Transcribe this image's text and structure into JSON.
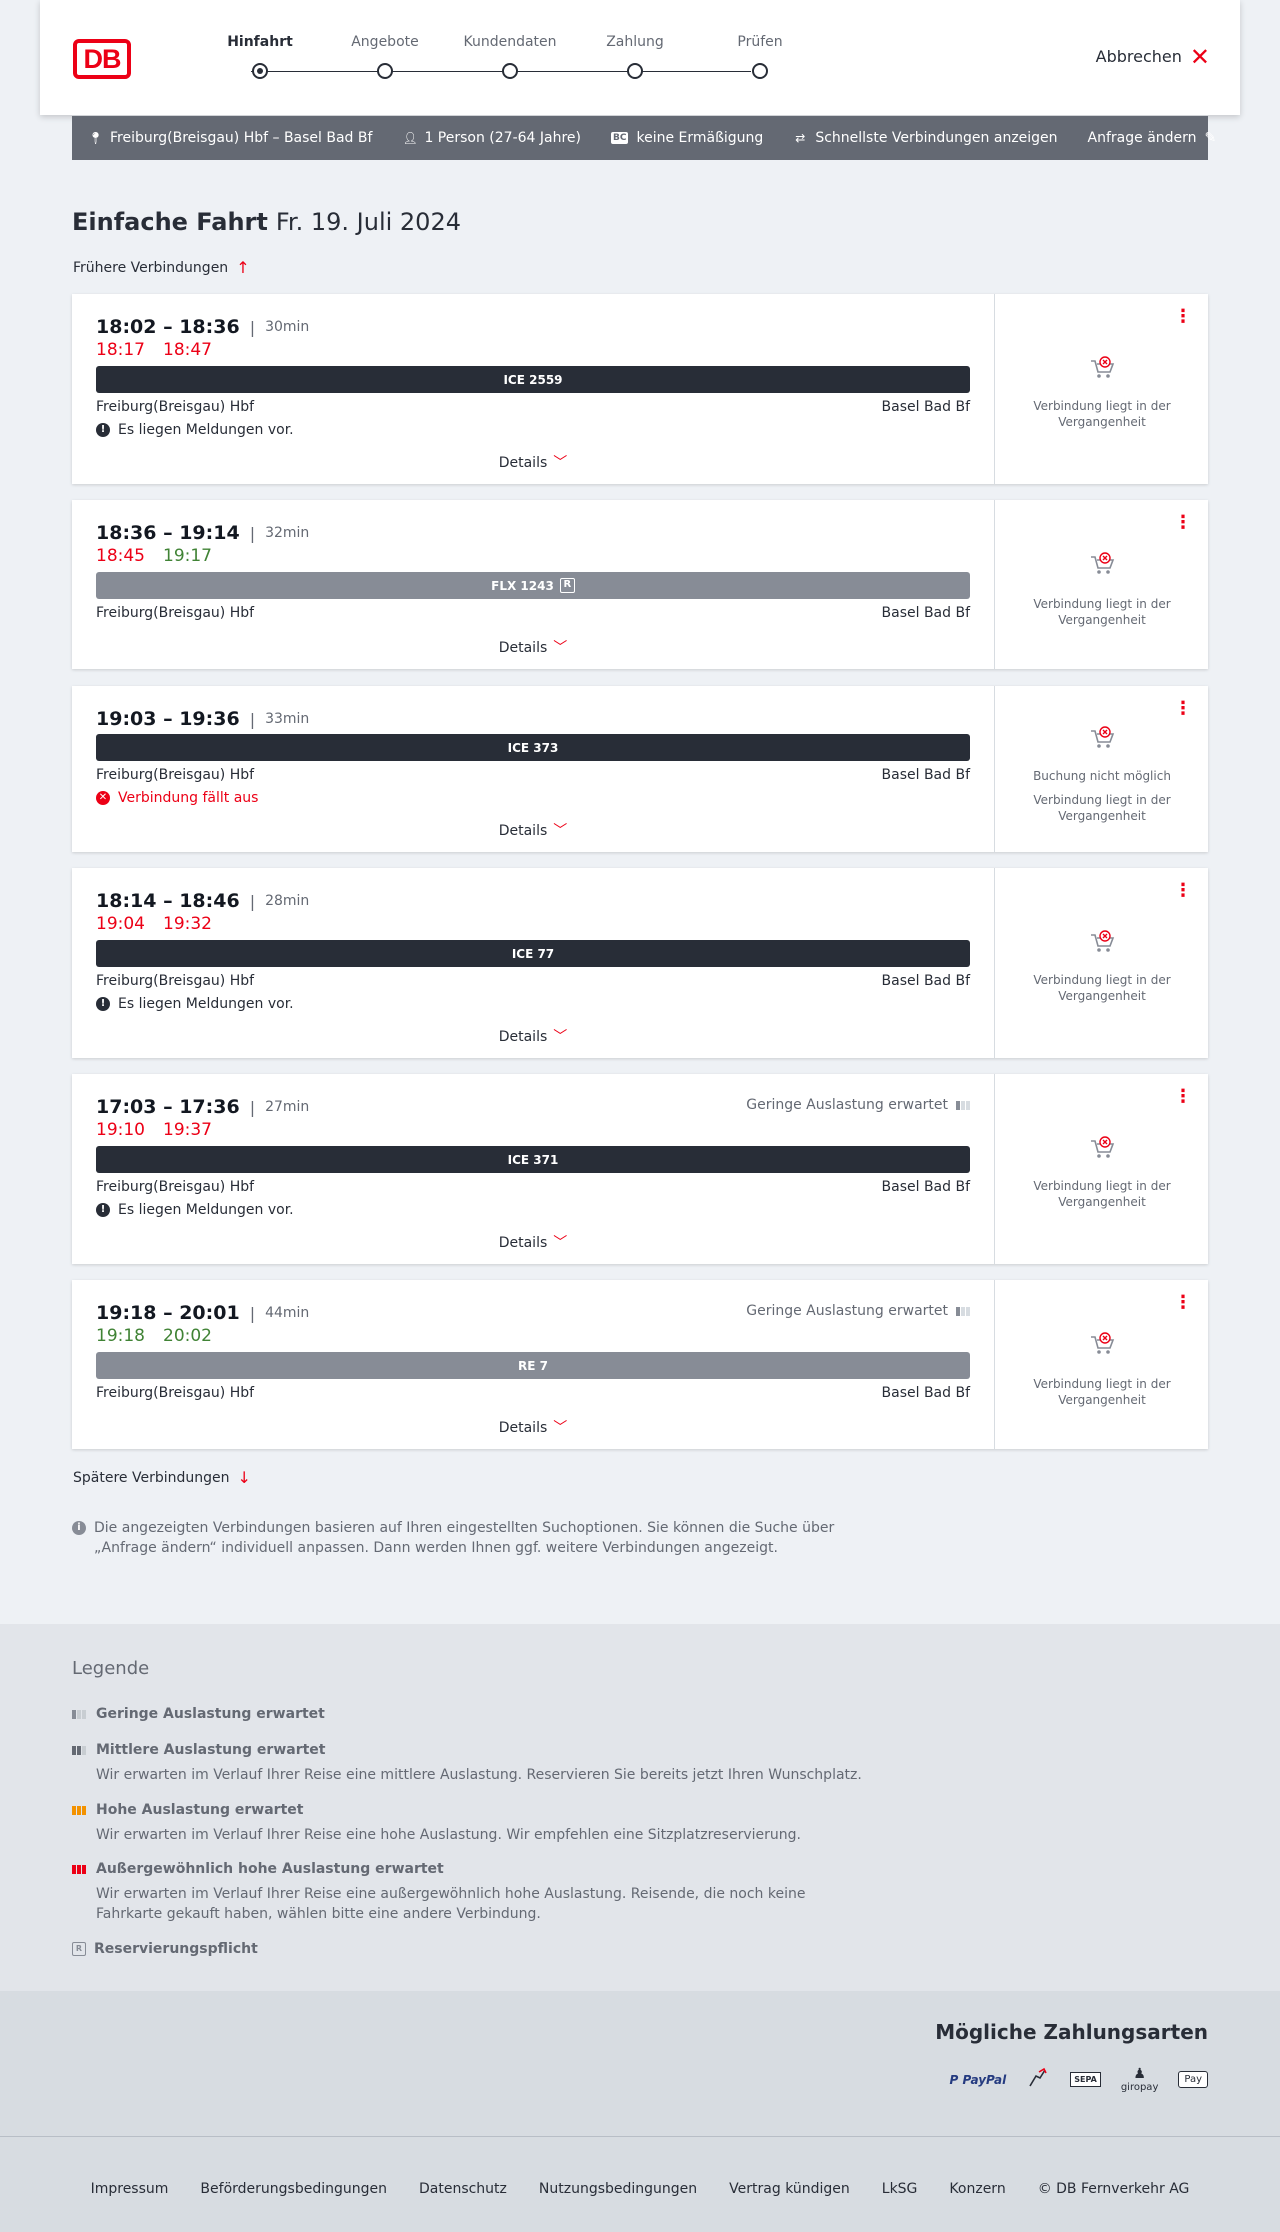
{
  "header": {
    "logo_text": "DB",
    "steps": [
      {
        "label": "Hinfahrt",
        "active": true
      },
      {
        "label": "Angebote",
        "active": false
      },
      {
        "label": "Kundendaten",
        "active": false
      },
      {
        "label": "Zahlung",
        "active": false
      },
      {
        "label": "Prüfen",
        "active": false
      }
    ],
    "cancel_label": "Abbrechen"
  },
  "search": {
    "route": "Freiburg(Breisgau) Hbf – Basel Bad Bf",
    "passengers": "1 Person (27-64 Jahre)",
    "discount_badge": "BC",
    "discount": "keine Ermäßigung",
    "option": "Schnellste Verbindungen anzeigen",
    "modify_label": "Anfrage ändern"
  },
  "title": {
    "trip_type": "Einfache Fahrt",
    "date": "Fr. 19. Juli 2024"
  },
  "earlier_label": "Frühere Verbindungen",
  "later_label": "Spätere Verbindungen",
  "connections": [
    {
      "time": "18:02 – 18:36",
      "duration": "30min",
      "rt_dep": "18:17",
      "rt_arr": "18:47",
      "train": "ICE 2559",
      "from": "Freiburg(Breisgau) Hbf",
      "to": "Basel Bad Bf",
      "message": "Es liegen Meldungen vor.",
      "details": "Details",
      "status": "Verbindung liegt in der Vergangenheit"
    },
    {
      "time": "18:36 – 19:14",
      "duration": "32min",
      "rt_dep": "18:45",
      "rt_arr": "19:17",
      "train": "FLX 1243",
      "reservation_badge": "R",
      "from": "Freiburg(Breisgau) Hbf",
      "to": "Basel Bad Bf",
      "details": "Details",
      "status": "Verbindung liegt in der Vergangenheit"
    },
    {
      "time": "19:03 – 19:36",
      "duration": "33min",
      "train": "ICE 373",
      "from": "Freiburg(Breisgau) Hbf",
      "to": "Basel Bad Bf",
      "cancel_message": "Verbindung fällt aus",
      "details": "Details",
      "booking": "Buchung nicht möglich",
      "status": "Verbindung liegt in der Vergangenheit"
    },
    {
      "time": "18:14 – 18:46",
      "duration": "28min",
      "rt_dep": "19:04",
      "rt_arr": "19:32",
      "train": "ICE 77",
      "from": "Freiburg(Breisgau) Hbf",
      "to": "Basel Bad Bf",
      "message": "Es liegen Meldungen vor.",
      "details": "Details",
      "status": "Verbindung liegt in der Vergangenheit"
    },
    {
      "time": "17:03 – 17:36",
      "duration": "27min",
      "load": "Geringe Auslastung erwartet",
      "rt_dep": "19:10",
      "rt_arr": "19:37",
      "train": "ICE 371",
      "from": "Freiburg(Breisgau) Hbf",
      "to": "Basel Bad Bf",
      "message": "Es liegen Meldungen vor.",
      "details": "Details",
      "status": "Verbindung liegt in der Vergangenheit"
    },
    {
      "time": "19:18 – 20:01",
      "duration": "44min",
      "load": "Geringe Auslastung erwartet",
      "rt_dep": "19:18",
      "rt_arr": "20:02",
      "train": "RE 7",
      "from": "Freiburg(Breisgau) Hbf",
      "to": "Basel Bad Bf",
      "details": "Details",
      "status": "Verbindung liegt in der Vergangenheit"
    }
  ],
  "note": "Die angezeigten Verbindungen basieren auf Ihren eingestellten Suchoptionen. Sie können die Suche über „Anfrage ändern“ individuell anpassen. Dann werden Ihnen ggf. weitere Verbindungen angezeigt.",
  "legend": {
    "title": "Legende",
    "items": [
      {
        "title": "Geringe Auslastung erwartet",
        "desc": ""
      },
      {
        "title": "Mittlere Auslastung erwartet",
        "desc": "Wir erwarten im Verlauf Ihrer Reise eine mittlere Auslastung. Reservieren Sie bereits jetzt Ihren Wunschplatz."
      },
      {
        "title": "Hohe Auslastung erwartet",
        "desc": "Wir erwarten im Verlauf Ihrer Reise eine hohe Auslastung. Wir empfehlen eine Sitzplatzreservierung."
      },
      {
        "title": "Außergewöhnlich hohe Auslastung erwartet",
        "desc": "Wir erwarten im Verlauf Ihrer Reise eine außergewöhnlich hohe Auslastung. Reisende, die noch keine Fahrkarte gekauft haben, wählen bitte eine andere Verbindung."
      },
      {
        "title": "Reservierungspflicht",
        "desc": ""
      }
    ]
  },
  "payment": {
    "title": "Mögliche Zahlungsarten",
    "methods": [
      "PayPal",
      "SEPA",
      "giropay",
      "Pay"
    ]
  },
  "footer": {
    "links": [
      "Impressum",
      "Beförderungsbedingungen",
      "Datenschutz",
      "Nutzungsbedingungen",
      "Vertrag kündigen",
      "LkSG",
      "Konzern"
    ],
    "copyright": "© DB Fernverkehr AG"
  },
  "colors": {
    "db_red": "#ec0016",
    "dark": "#282d37",
    "delay_red": "#ec0016",
    "ontime_green": "#408335"
  }
}
